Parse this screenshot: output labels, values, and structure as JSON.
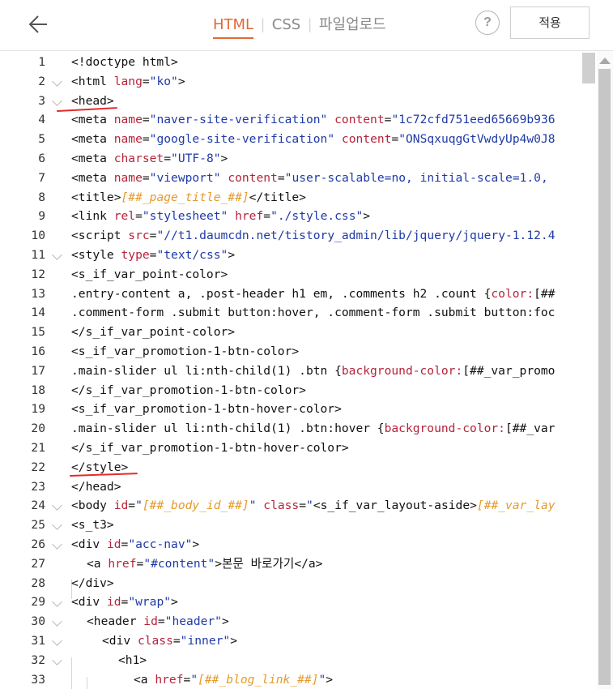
{
  "toolbar": {
    "tabs": [
      "HTML",
      "CSS",
      "파일업로드"
    ],
    "help_label": "?",
    "apply_label": "적용"
  },
  "editor": {
    "lines": [
      {
        "n": "1",
        "html": "&lt;!doctype html&gt;"
      },
      {
        "n": "2",
        "fold": true,
        "html": "&lt;html <span class=\"a\">lang</span>=<span class=\"s\">\"ko\"</span>&gt;"
      },
      {
        "n": "3",
        "fold": true,
        "html": "&lt;head&gt;"
      },
      {
        "n": "4",
        "html": "&lt;meta <span class=\"a\">name</span>=<span class=\"s\">\"naver-site-verification\"</span> <span class=\"a\">content</span>=<span class=\"s\">\"1c72cfd751eed65669b936</span>"
      },
      {
        "n": "5",
        "html": "&lt;meta <span class=\"a\">name</span>=<span class=\"s\">\"google-site-verification\"</span> <span class=\"a\">content</span>=<span class=\"s\">\"ONSqxuqgGtVwdyUp4w0J8</span>"
      },
      {
        "n": "6",
        "html": "&lt;meta <span class=\"a\">charset</span>=<span class=\"s\">\"UTF-8\"</span>&gt;"
      },
      {
        "n": "7",
        "html": "&lt;meta <span class=\"a\">name</span>=<span class=\"s\">\"viewport\"</span> <span class=\"a\">content</span>=<span class=\"s\">\"user-scalable=no, initial-scale=1.0,</span>"
      },
      {
        "n": "8",
        "html": "&lt;title&gt;<span class=\"t\">[##_page_title_##]</span>&lt;/title&gt;"
      },
      {
        "n": "9",
        "html": "&lt;link <span class=\"a\">rel</span>=<span class=\"s\">\"stylesheet\"</span> <span class=\"a\">href</span>=<span class=\"s\">\"./style.css\"</span>&gt;"
      },
      {
        "n": "10",
        "html": "&lt;script <span class=\"a\">src</span>=<span class=\"s\">\"//t1.daumcdn.net/tistory_admin/lib/jquery/jquery-1.12.4</span>"
      },
      {
        "n": "11",
        "fold": true,
        "html": "&lt;style <span class=\"a\">type</span>=<span class=\"s\">\"text/css\"</span>&gt;"
      },
      {
        "n": "12",
        "html": "&lt;s_if_var_point-color&gt;"
      },
      {
        "n": "13",
        "html": ".entry-content a, .post-header h1 em, .comments h2 .count {<span class=\"a\">color:</span>[##"
      },
      {
        "n": "14",
        "html": ".comment-form .submit button:hover, .comment-form .submit button:foc"
      },
      {
        "n": "15",
        "html": "&lt;/s_if_var_point-color&gt;"
      },
      {
        "n": "16",
        "html": "&lt;s_if_var_promotion-1-btn-color&gt;"
      },
      {
        "n": "17",
        "html": ".main-slider ul li:nth-child(1) .btn {<span class=\"a\">background-color:</span>[##_var_promo"
      },
      {
        "n": "18",
        "html": "&lt;/s_if_var_promotion-1-btn-color&gt;"
      },
      {
        "n": "19",
        "html": "&lt;s_if_var_promotion-1-btn-hover-color&gt;"
      },
      {
        "n": "20",
        "html": ".main-slider ul li:nth-child(1) .btn:hover {<span class=\"a\">background-color:</span>[##_var"
      },
      {
        "n": "21",
        "html": "&lt;/s_if_var_promotion-1-btn-hover-color&gt;"
      },
      {
        "n": "22",
        "html": "&lt;/style&gt;"
      },
      {
        "n": "23",
        "html": "&lt;/head&gt;"
      },
      {
        "n": "24",
        "fold": true,
        "html": "&lt;body <span class=\"a\">id</span>=<span class=\"s\">\"</span><span class=\"t\">[##_body_id_##]</span><span class=\"s\">\"</span> <span class=\"a\">class</span>=<span class=\"s\">\"</span>&lt;s_if_var_layout-aside&gt;<span class=\"t\">[##_var_lay</span>"
      },
      {
        "n": "25",
        "fold": true,
        "html": "&lt;s_t3&gt;"
      },
      {
        "n": "26",
        "fold": true,
        "html": "&lt;div <span class=\"a\">id</span>=<span class=\"s\">\"acc-nav\"</span>&gt;"
      },
      {
        "n": "27",
        "indent": 1,
        "html": "&lt;a <span class=\"a\">href</span>=<span class=\"s\">\"#content\"</span>&gt;본문 바로가기&lt;/a&gt;"
      },
      {
        "n": "28",
        "html": "&lt;/div&gt;"
      },
      {
        "n": "29",
        "fold": true,
        "html": "&lt;div <span class=\"a\">id</span>=<span class=\"s\">\"wrap\"</span>&gt;"
      },
      {
        "n": "30",
        "fold": true,
        "indent": 1,
        "html": "&lt;header <span class=\"a\">id</span>=<span class=\"s\">\"header\"</span>&gt;"
      },
      {
        "n": "31",
        "fold": true,
        "indent": 2,
        "html": "&lt;div <span class=\"a\">class</span>=<span class=\"s\">\"inner\"</span>&gt;"
      },
      {
        "n": "32",
        "fold": true,
        "indent": 3,
        "html": "&lt;h1&gt;"
      },
      {
        "n": "33",
        "indent": 4,
        "html": "&lt;a <span class=\"a\">href</span>=<span class=\"s\">\"</span><span class=\"t\">[##_blog_link_##]</span><span class=\"s\">\"</span>&gt;"
      }
    ]
  },
  "colors": {
    "accent": "#e06a35",
    "attribute": "#b5243a",
    "string": "#1f3aa6",
    "template_var": "#e59a2b",
    "annotation": "#e22c2c"
  }
}
